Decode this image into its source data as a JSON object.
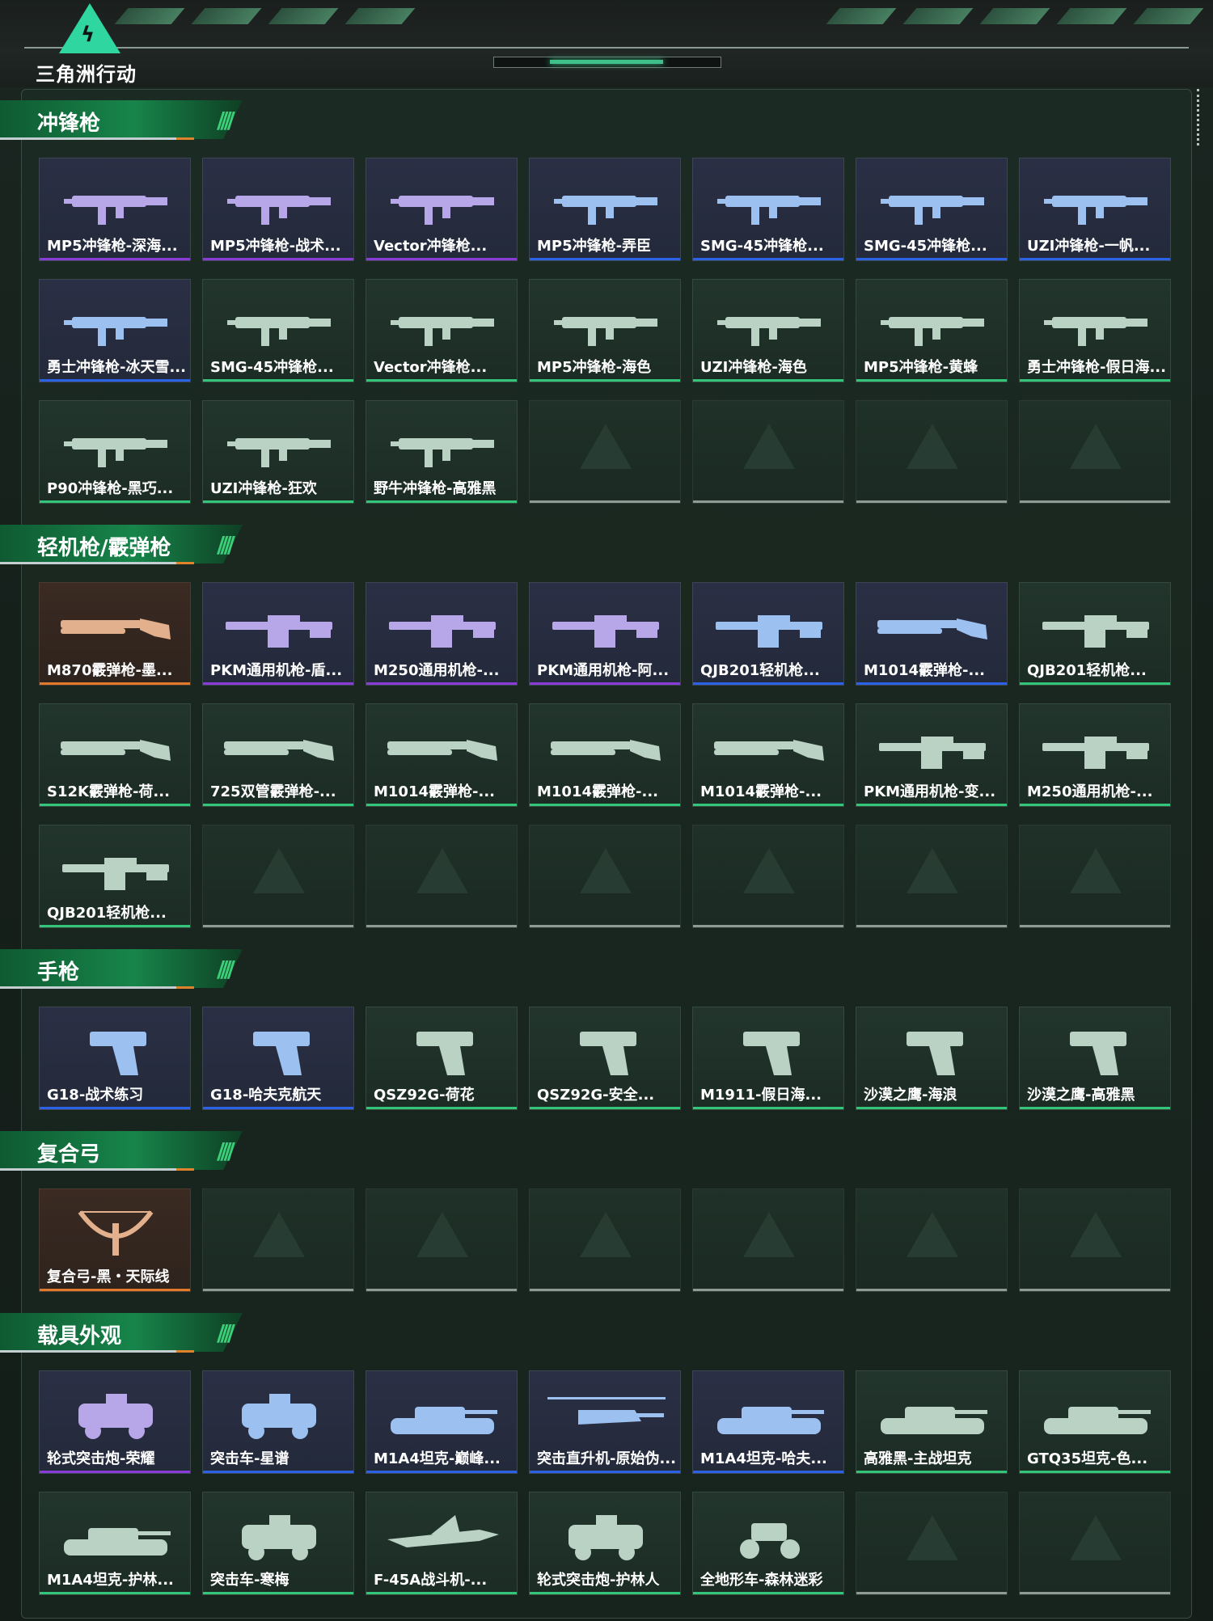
{
  "header": {
    "logo_text": "三角洲行动",
    "logo_icon": "delta-triangle-icon"
  },
  "colors": {
    "blue": "#2c63e6",
    "green": "#33c67a",
    "purple": "#8a3cd6",
    "orange": "#e07a2c",
    "gray": "#8f9996"
  },
  "sections": [
    {
      "title": "冲锋枪",
      "items": [
        {
          "label": "MP5冲锋枪-深海...",
          "rarity": "purple",
          "icon": "smg-icon"
        },
        {
          "label": "MP5冲锋枪-战术...",
          "rarity": "purple",
          "icon": "smg-icon"
        },
        {
          "label": "Vector冲锋枪...",
          "rarity": "purple",
          "icon": "smg-icon"
        },
        {
          "label": "MP5冲锋枪-弄臣",
          "rarity": "blue",
          "icon": "smg-icon"
        },
        {
          "label": "SMG-45冲锋枪...",
          "rarity": "blue",
          "icon": "smg-icon"
        },
        {
          "label": "SMG-45冲锋枪...",
          "rarity": "blue",
          "icon": "smg-icon"
        },
        {
          "label": "UZI冲锋枪-一帆...",
          "rarity": "blue",
          "icon": "smg-icon"
        },
        {
          "label": "勇士冲锋枪-冰天雪...",
          "rarity": "blue",
          "icon": "smg-icon"
        },
        {
          "label": "SMG-45冲锋枪...",
          "rarity": "green",
          "icon": "smg-icon"
        },
        {
          "label": "Vector冲锋枪...",
          "rarity": "green",
          "icon": "smg-icon"
        },
        {
          "label": "MP5冲锋枪-海色",
          "rarity": "green",
          "icon": "smg-icon"
        },
        {
          "label": "UZI冲锋枪-海色",
          "rarity": "green",
          "icon": "smg-icon"
        },
        {
          "label": "MP5冲锋枪-黄蜂",
          "rarity": "green",
          "icon": "smg-icon"
        },
        {
          "label": "勇士冲锋枪-假日海...",
          "rarity": "green",
          "icon": "smg-icon"
        },
        {
          "label": "P90冲锋枪-黑巧...",
          "rarity": "green",
          "icon": "smg-icon"
        },
        {
          "label": "UZI冲锋枪-狂欢",
          "rarity": "green",
          "icon": "smg-icon"
        },
        {
          "label": "野牛冲锋枪-高雅黑",
          "rarity": "green",
          "icon": "smg-icon"
        }
      ]
    },
    {
      "title": "轻机枪/霰弹枪",
      "items": [
        {
          "label": "M870霰弹枪-墨...",
          "rarity": "orange",
          "icon": "shotgun-icon"
        },
        {
          "label": "PKM通用机枪-盾...",
          "rarity": "purple",
          "icon": "lmg-icon"
        },
        {
          "label": "M250通用机枪-...",
          "rarity": "purple",
          "icon": "lmg-icon"
        },
        {
          "label": "PKM通用机枪-阿...",
          "rarity": "purple",
          "icon": "lmg-icon"
        },
        {
          "label": "QJB201轻机枪...",
          "rarity": "blue",
          "icon": "lmg-icon"
        },
        {
          "label": "M1014霰弹枪-...",
          "rarity": "blue",
          "icon": "shotgun-icon"
        },
        {
          "label": "QJB201轻机枪...",
          "rarity": "green",
          "icon": "lmg-icon"
        },
        {
          "label": "S12K霰弹枪-荷...",
          "rarity": "green",
          "icon": "shotgun-icon"
        },
        {
          "label": "725双管霰弹枪-...",
          "rarity": "green",
          "icon": "shotgun-icon"
        },
        {
          "label": "M1014霰弹枪-...",
          "rarity": "green",
          "icon": "shotgun-icon"
        },
        {
          "label": "M1014霰弹枪-...",
          "rarity": "green",
          "icon": "shotgun-icon"
        },
        {
          "label": "M1014霰弹枪-...",
          "rarity": "green",
          "icon": "shotgun-icon"
        },
        {
          "label": "PKM通用机枪-变...",
          "rarity": "green",
          "icon": "lmg-icon"
        },
        {
          "label": "M250通用机枪-...",
          "rarity": "green",
          "icon": "lmg-icon"
        },
        {
          "label": "QJB201轻机枪...",
          "rarity": "green",
          "icon": "lmg-icon"
        }
      ]
    },
    {
      "title": "手枪",
      "items": [
        {
          "label": "G18-战术练习",
          "rarity": "blue",
          "icon": "pistol-icon"
        },
        {
          "label": "G18-哈夫克航天",
          "rarity": "blue",
          "icon": "pistol-icon"
        },
        {
          "label": "QSZ92G-荷花",
          "rarity": "green",
          "icon": "pistol-icon"
        },
        {
          "label": "QSZ92G-安全...",
          "rarity": "green",
          "icon": "pistol-icon"
        },
        {
          "label": "M1911-假日海...",
          "rarity": "green",
          "icon": "pistol-icon"
        },
        {
          "label": "沙漠之鹰-海浪",
          "rarity": "green",
          "icon": "pistol-icon"
        },
        {
          "label": "沙漠之鹰-高雅黑",
          "rarity": "green",
          "icon": "pistol-icon"
        }
      ]
    },
    {
      "title": "复合弓",
      "items": [
        {
          "label": "复合弓-黑・天际线",
          "rarity": "orange",
          "icon": "bow-icon"
        }
      ]
    },
    {
      "title": "载具外观",
      "items": [
        {
          "label": "轮式突击炮-荣耀",
          "rarity": "purple",
          "icon": "vehicle-icon"
        },
        {
          "label": "突击车-星谱",
          "rarity": "blue",
          "icon": "vehicle-icon"
        },
        {
          "label": "M1A4坦克-巅峰...",
          "rarity": "blue",
          "icon": "tank-icon"
        },
        {
          "label": "突击直升机-原始伪...",
          "rarity": "blue",
          "icon": "helicopter-icon"
        },
        {
          "label": "M1A4坦克-哈夫...",
          "rarity": "blue",
          "icon": "tank-icon"
        },
        {
          "label": "高雅黑-主战坦克",
          "rarity": "green",
          "icon": "tank-icon"
        },
        {
          "label": "GTQ35坦克-色...",
          "rarity": "green",
          "icon": "tank-icon"
        },
        {
          "label": "M1A4坦克-护林...",
          "rarity": "green",
          "icon": "tank-icon"
        },
        {
          "label": "突击车-寒梅",
          "rarity": "green",
          "icon": "vehicle-icon"
        },
        {
          "label": "F-45A战斗机-...",
          "rarity": "green",
          "icon": "jet-icon"
        },
        {
          "label": "轮式突击炮-护林人",
          "rarity": "green",
          "icon": "vehicle-icon"
        },
        {
          "label": "全地形车-森林迷彩",
          "rarity": "green",
          "icon": "atv-icon"
        }
      ]
    }
  ]
}
